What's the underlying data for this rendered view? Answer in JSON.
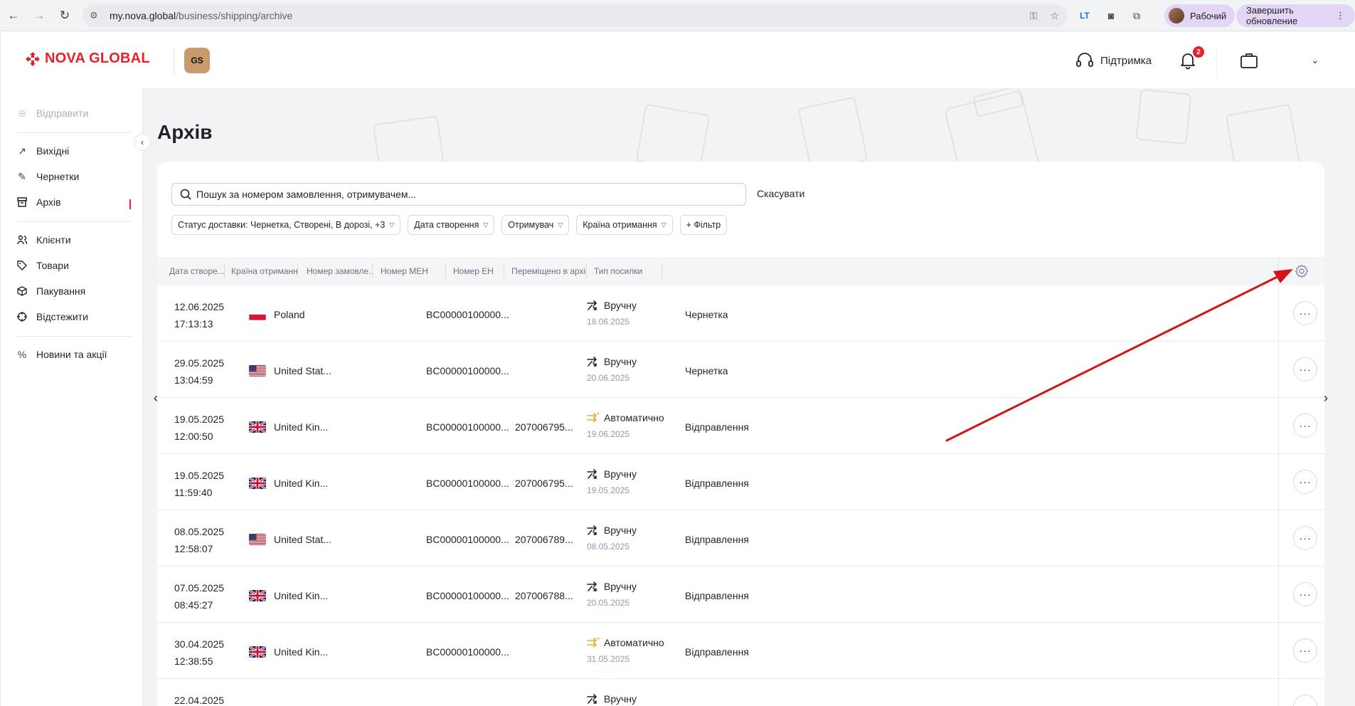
{
  "browser": {
    "url_host": "my.nova.global",
    "url_path": "/business/shipping/archive",
    "profile_label": "Рабочий",
    "update_label": "Завершить обновление"
  },
  "header": {
    "logo_text": "NOVA GLOBAL",
    "badge_text": "GS",
    "support_label": "Підтримка",
    "notifications_count": "2"
  },
  "sidebar": {
    "send_label": "Відправити",
    "items": [
      {
        "label": "Вихідні",
        "icon": "arrow-up-right-icon"
      },
      {
        "label": "Чернетки",
        "icon": "edit-icon"
      },
      {
        "label": "Архів",
        "icon": "archive-icon",
        "active": true
      },
      {
        "label": "Клієнти",
        "icon": "users-icon"
      },
      {
        "label": "Товари",
        "icon": "tag-icon"
      },
      {
        "label": "Пакування",
        "icon": "package-icon"
      },
      {
        "label": "Відстежити",
        "icon": "crosshair-icon"
      },
      {
        "label": "Новини та акції",
        "icon": "percent-icon"
      }
    ]
  },
  "page": {
    "title": "Архів",
    "search_placeholder": "Пошук за номером замовлення, отримувачем...",
    "cancel_label": "Скасувати"
  },
  "filters": [
    "Статус доставки: Чернетка, Створені, В дорозі, +3",
    "Дата створення",
    "Отримувач",
    "Країна отримання",
    "+ Фільтр"
  ],
  "table": {
    "columns": [
      "Дата створе...",
      "Країна отримання",
      "Номер замовле...",
      "Номер МЕН",
      "Номер ЕН",
      "Переміщено в архів",
      "Тип посилки"
    ],
    "rows": [
      {
        "date": "12.06.2025",
        "time": "17:13:13",
        "flag": "pl",
        "country": "Poland",
        "mehn": "BC00000100000...",
        "en": "",
        "move": "Вручну",
        "move_type": "manual",
        "move_date": "18.06.2025",
        "type": "Чернетка"
      },
      {
        "date": "29.05.2025",
        "time": "13:04:59",
        "flag": "us",
        "country": "United Stat...",
        "mehn": "BC00000100000...",
        "en": "",
        "move": "Вручну",
        "move_type": "manual",
        "move_date": "20.06.2025",
        "type": "Чернетка"
      },
      {
        "date": "19.05.2025",
        "time": "12:00:50",
        "flag": "gb",
        "country": "United Kin...",
        "mehn": "BC00000100000...",
        "en": "207006795...",
        "move": "Автоматично",
        "move_type": "auto",
        "move_date": "19.06.2025",
        "type": "Відправлення"
      },
      {
        "date": "19.05.2025",
        "time": "11:59:40",
        "flag": "gb",
        "country": "United Kin...",
        "mehn": "BC00000100000...",
        "en": "207006795...",
        "move": "Вручну",
        "move_type": "manual",
        "move_date": "19.05.2025",
        "type": "Відправлення"
      },
      {
        "date": "08.05.2025",
        "time": "12:58:07",
        "flag": "us",
        "country": "United Stat...",
        "mehn": "BC00000100000...",
        "en": "207006789...",
        "move": "Вручну",
        "move_type": "manual",
        "move_date": "08.05.2025",
        "type": "Відправлення"
      },
      {
        "date": "07.05.2025",
        "time": "08:45:27",
        "flag": "gb",
        "country": "United Kin...",
        "mehn": "BC00000100000...",
        "en": "207006788...",
        "move": "Вручну",
        "move_type": "manual",
        "move_date": "20.05.2025",
        "type": "Відправлення"
      },
      {
        "date": "30.04.2025",
        "time": "12:38:55",
        "flag": "gb",
        "country": "United Kin...",
        "mehn": "BC00000100000...",
        "en": "",
        "move": "Автоматично",
        "move_type": "auto",
        "move_date": "31.05.2025",
        "type": "Відправлення"
      },
      {
        "date": "22.04.2025",
        "time": "",
        "flag": "",
        "country": "",
        "mehn": "",
        "en": "",
        "move": "Вручну",
        "move_type": "manual",
        "move_date": "",
        "type": ""
      }
    ]
  },
  "colors": {
    "brand_red": "#e3222d",
    "auto_orange": "#f5a623",
    "annotation_arrow": "#d3141b"
  }
}
